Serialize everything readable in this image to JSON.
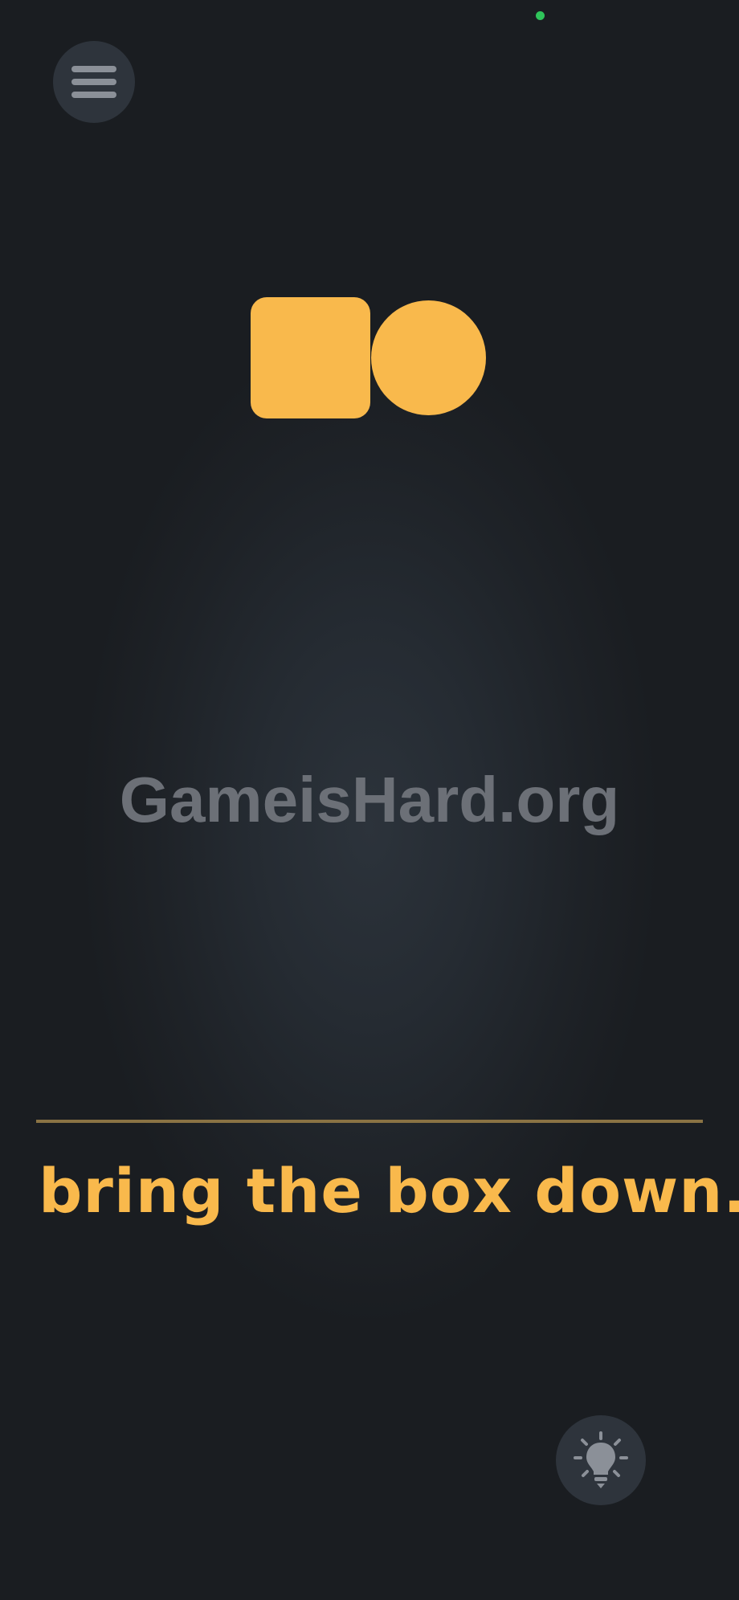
{
  "header": {
    "menu_icon": "hamburger-menu-icon"
  },
  "puzzle": {
    "shapes": [
      {
        "name": "box",
        "color": "#f9b94c"
      },
      {
        "name": "ball",
        "color": "#f9b94c"
      }
    ]
  },
  "watermark": {
    "text": "GameisHard.org"
  },
  "level": {
    "instruction": "bring the box down.",
    "accent_color": "#f9b94c"
  },
  "footer": {
    "hint_icon": "lightbulb-icon"
  }
}
